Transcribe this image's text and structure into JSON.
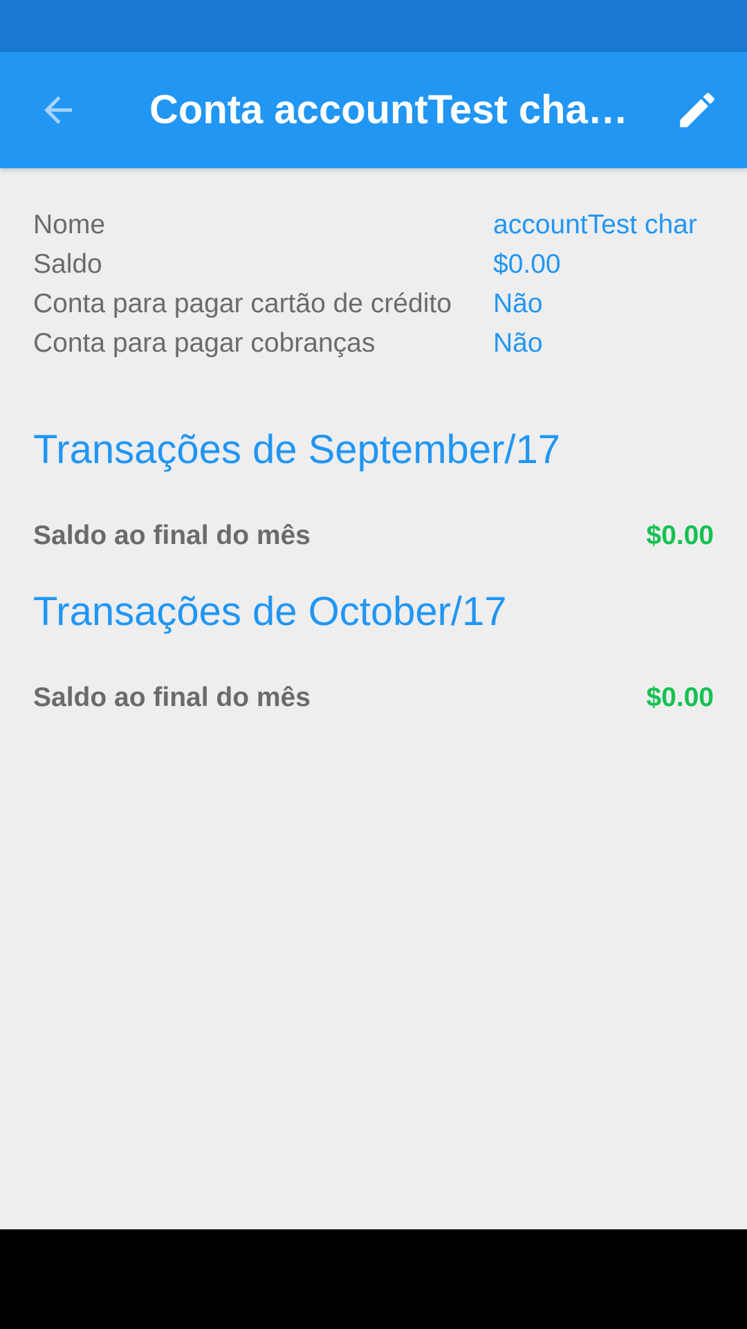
{
  "app_bar": {
    "title": "Conta accountTest chan…",
    "back_icon": "arrow-back-icon",
    "edit_icon": "pencil-icon",
    "color": "#2196f3",
    "status_color": "#1b78d2"
  },
  "account_info": {
    "rows": [
      {
        "label": "Nome",
        "value": "accountTest char"
      },
      {
        "label": "Saldo",
        "value": "$0.00"
      },
      {
        "label": "Conta para pagar cartão de crédito",
        "value": "Não"
      },
      {
        "label": "Conta para pagar cobranças",
        "value": "Não"
      }
    ]
  },
  "months": [
    {
      "title": "Transações de September/17",
      "summary_label": "Saldo ao final do mês",
      "summary_value": "$0.00"
    },
    {
      "title": "Transações de October/17",
      "summary_label": "Saldo ao final do mês",
      "summary_value": "$0.00"
    }
  ],
  "colors": {
    "accent": "#2196f3",
    "positive": "#14c151",
    "text_secondary": "#6b6b6b"
  }
}
